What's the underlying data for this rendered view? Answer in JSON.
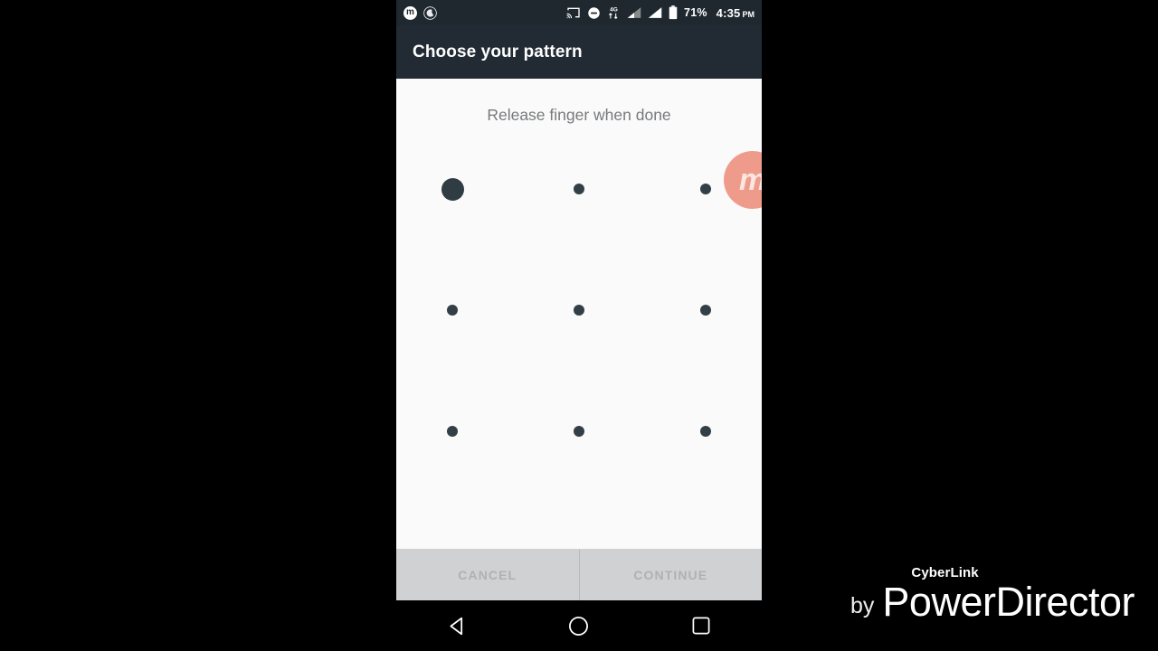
{
  "status_bar": {
    "left_icons": [
      {
        "name": "app-notification-icon",
        "glyph": "m"
      },
      {
        "name": "do-not-disturb-moon-icon",
        "glyph": "☾"
      }
    ],
    "right_icons": [
      {
        "name": "cast-icon"
      },
      {
        "name": "do-not-disturb-icon"
      },
      {
        "name": "network-4g-icon",
        "label": "4G"
      },
      {
        "name": "signal-sim1-icon"
      },
      {
        "name": "signal-sim2-icon"
      },
      {
        "name": "battery-icon"
      }
    ],
    "battery_percent": "71%",
    "time": "4:35",
    "meridiem": "PM"
  },
  "title_bar": {
    "title": "Choose your pattern"
  },
  "content": {
    "instruction": "Release finger when done",
    "watermark_badge_letter": "m",
    "pattern_grid": {
      "rows": [
        [
          {
            "state": "active"
          },
          {
            "state": "idle"
          },
          {
            "state": "idle"
          }
        ],
        [
          {
            "state": "idle"
          },
          {
            "state": "idle"
          },
          {
            "state": "idle"
          }
        ],
        [
          {
            "state": "idle"
          },
          {
            "state": "idle"
          },
          {
            "state": "idle"
          }
        ]
      ]
    }
  },
  "buttons": {
    "cancel_label": "CANCEL",
    "continue_label": "CONTINUE"
  },
  "nav_bar": {
    "back_label": "back-triangle-icon",
    "home_label": "home-circle-icon",
    "recents_label": "recents-square-icon"
  },
  "video_watermark": {
    "by": "by",
    "brand": "CyberLink",
    "product": "PowerDirector"
  },
  "colors": {
    "status_bar_bg": "#1f282f",
    "title_bar_bg": "#222b33",
    "content_bg": "#fafafa",
    "dot_color": "#333f46",
    "button_bar_bg": "#d0d1d3",
    "button_text": "#b0b1b3",
    "badge_accent": "#ef9b8c"
  }
}
